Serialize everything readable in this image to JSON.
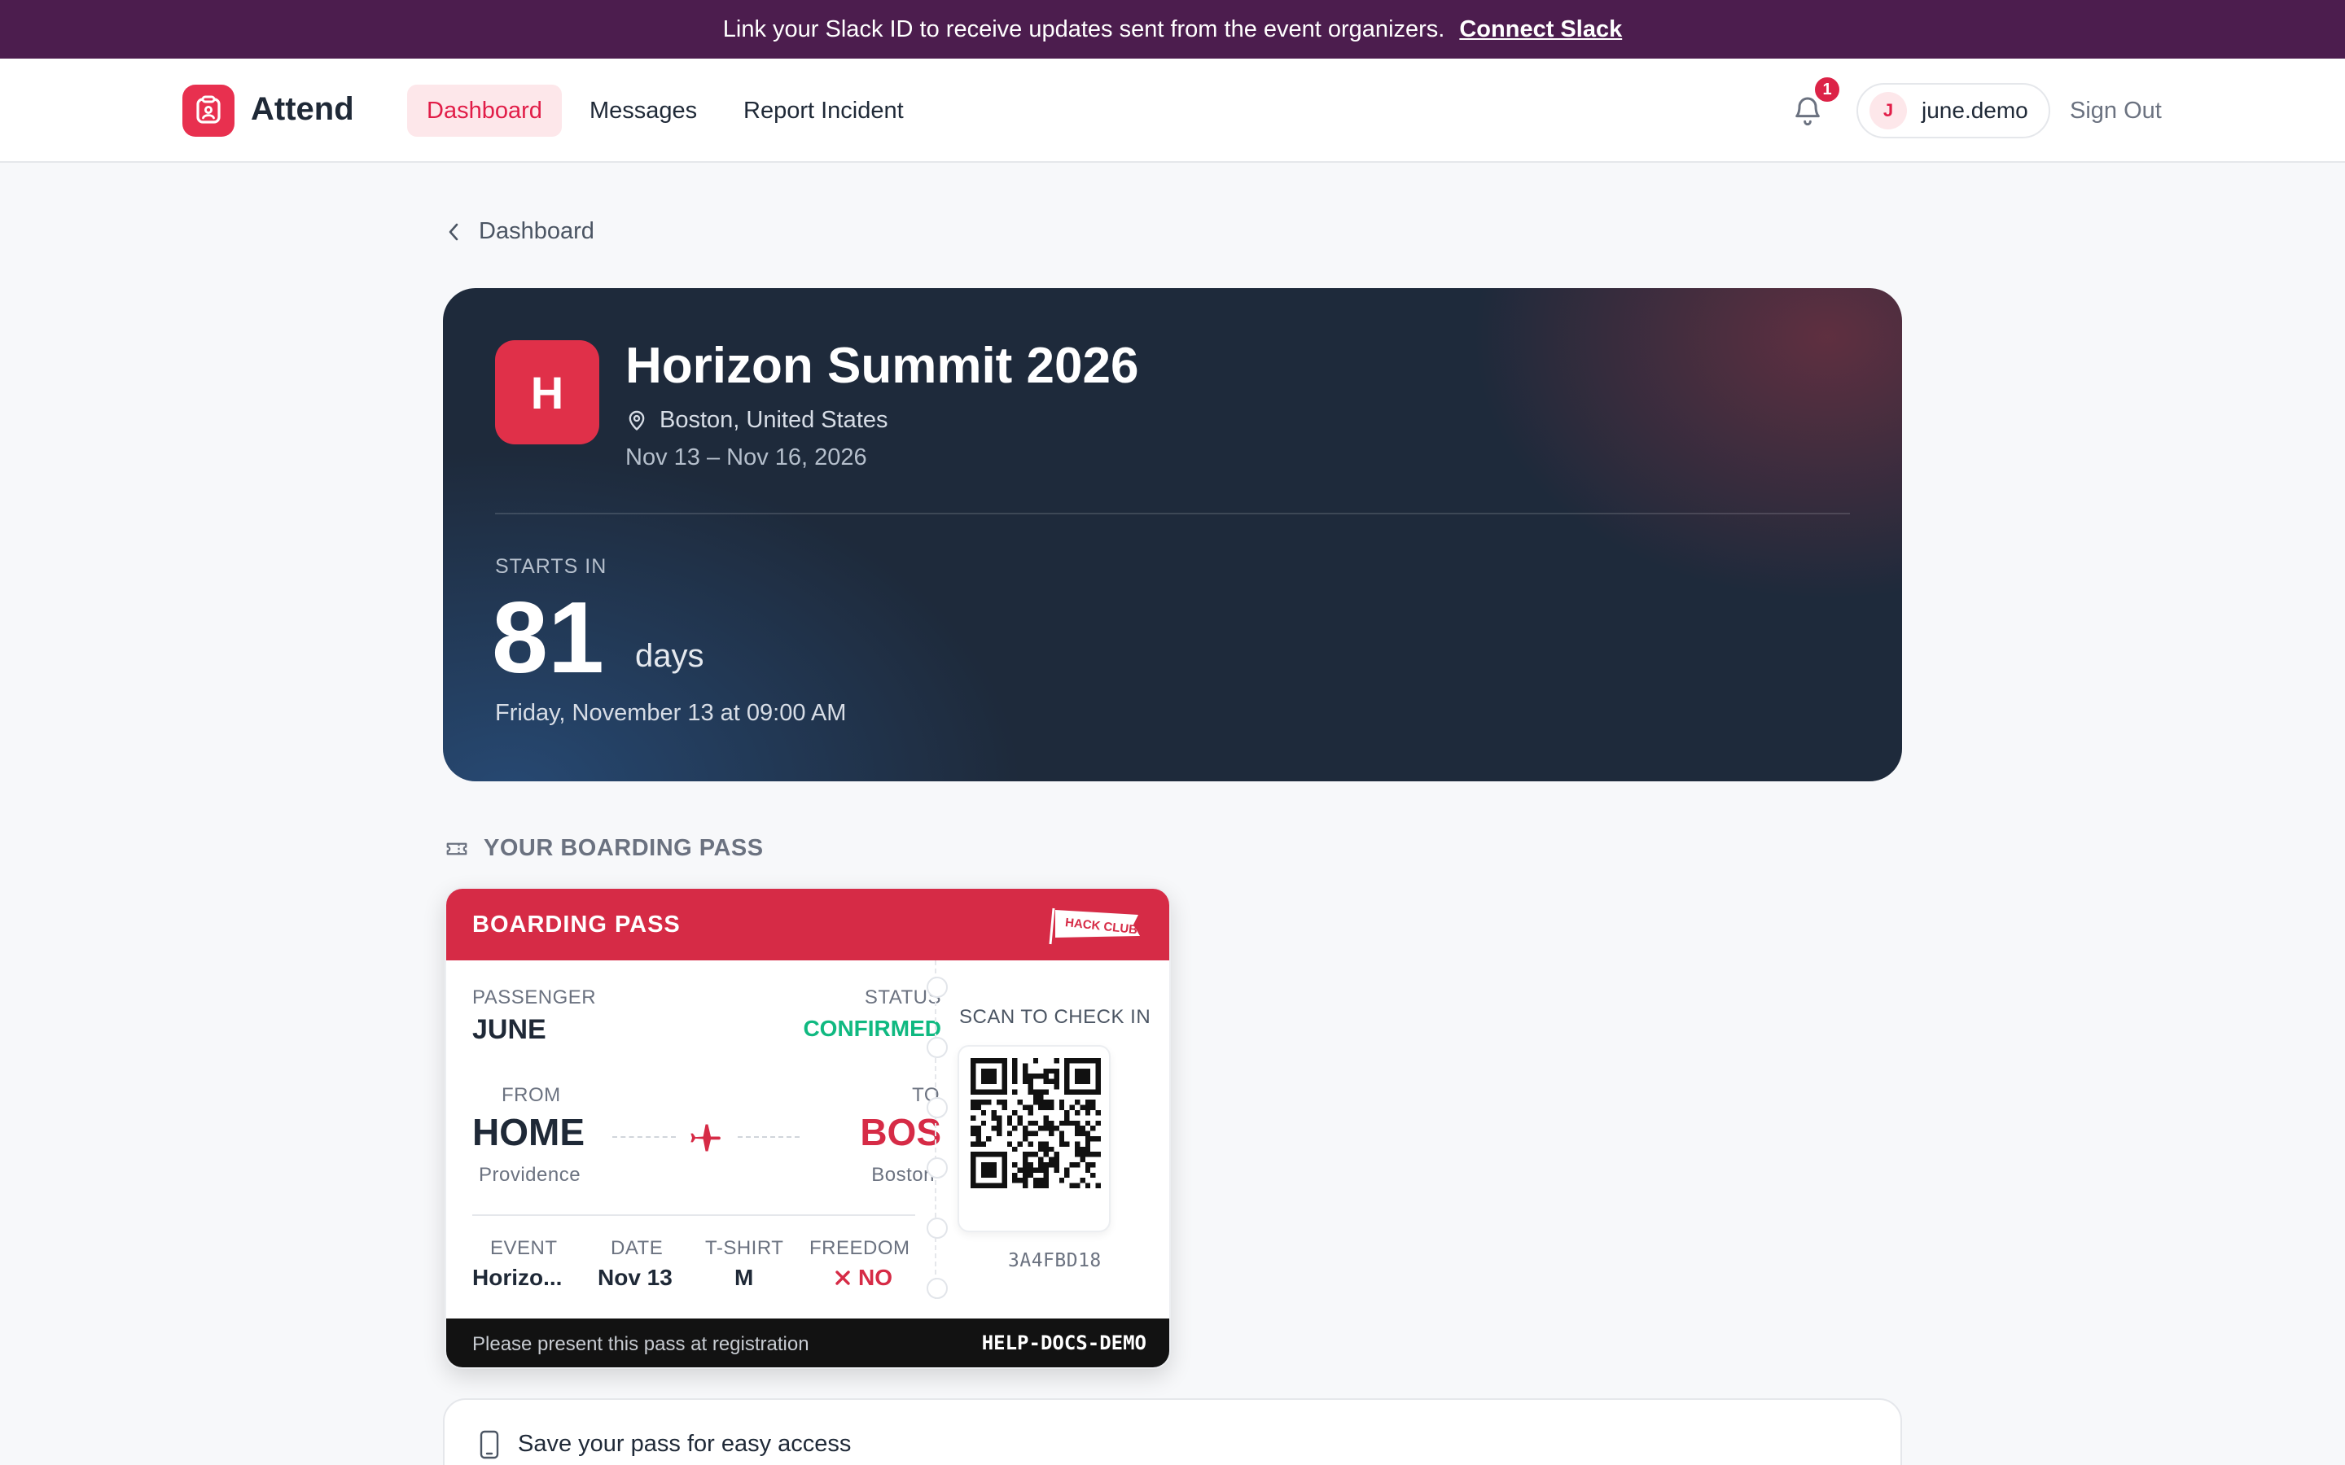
{
  "banner": {
    "message": "Link your Slack ID to receive updates sent from the event organizers.",
    "link": "Connect Slack"
  },
  "nav": {
    "brand": "Attend",
    "links": [
      "Dashboard",
      "Messages",
      "Report Incident"
    ],
    "active": "Dashboard",
    "notification_count": "1",
    "user_initial": "J",
    "username": "june.demo",
    "sign_out": "Sign Out"
  },
  "breadcrumb": {
    "back_label": "Dashboard"
  },
  "event": {
    "initial": "H",
    "title": "Horizon Summit 2026",
    "location": "Boston, United States",
    "dates": "Nov 13 – Nov 16, 2026",
    "starts_in_label": "STARTS IN",
    "countdown_value": "81",
    "countdown_unit": "days",
    "start_datetime": "Friday, November 13 at 09:00 AM"
  },
  "boarding_section": {
    "label": "YOUR BOARDING PASS"
  },
  "boarding_pass": {
    "header": "BOARDING PASS",
    "flag_text": "HACK CLUB",
    "passenger_label": "PASSENGER",
    "passenger": "JUNE",
    "status_label": "STATUS",
    "status": "CONFIRMED",
    "from_label": "FROM",
    "from_code": "HOME",
    "from_city": "Providence",
    "to_label": "TO",
    "to_code": "BOS",
    "to_city": "Boston",
    "event_label": "EVENT",
    "event_value": "Horizo...",
    "date_label": "DATE",
    "date_value": "Nov 13",
    "tshirt_label": "T-SHIRT",
    "tshirt_value": "M",
    "freedom_label": "FREEDOM",
    "freedom_value": "NO",
    "scan_label": "SCAN TO CHECK IN",
    "pass_id": "3A4FBD18",
    "footer_note": "Please present this pass at registration",
    "footer_code": "HELP-DOCS-DEMO"
  },
  "save_card": {
    "title": "Save your pass for easy access"
  },
  "icons": [
    "ticket-app-icon",
    "bell-icon",
    "chevron-left-icon",
    "map-pin-icon",
    "ticket-icon",
    "airplane-icon",
    "x-icon",
    "qr-code-icon",
    "phone-icon",
    "flag-icon"
  ],
  "colors": {
    "banner": "#4c1d4e",
    "accent": "#e11d48",
    "pass_header": "#d62b46",
    "confirmed": "#10b981",
    "hero_bg": "#1e2a3b"
  }
}
